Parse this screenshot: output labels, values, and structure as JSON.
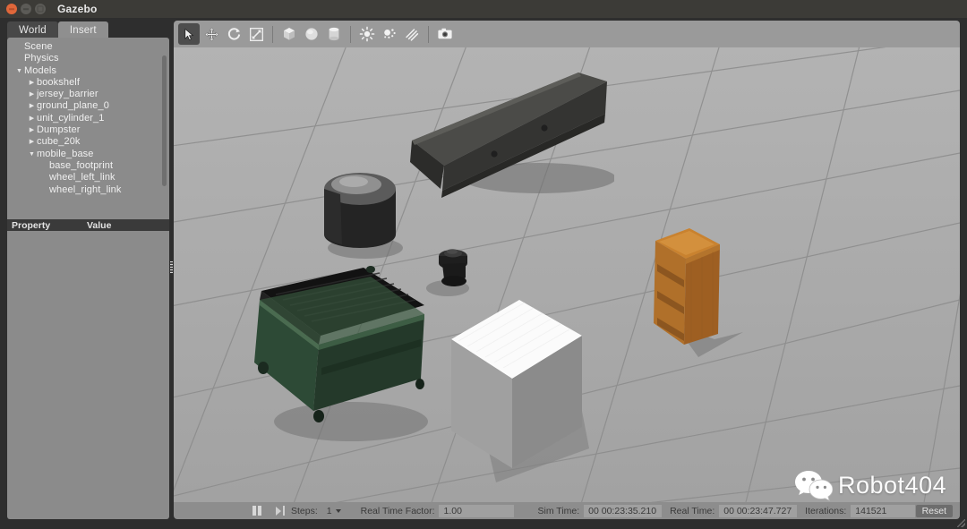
{
  "window": {
    "title": "Gazebo",
    "controls": [
      "close-button",
      "minimize-button",
      "maximize-button"
    ]
  },
  "left_panel": {
    "tabs": [
      {
        "label": "World",
        "active": true
      },
      {
        "label": "Insert",
        "active": false
      }
    ],
    "tree": [
      {
        "label": "Scene",
        "depth": 0,
        "arrow": "none"
      },
      {
        "label": "Physics",
        "depth": 0,
        "arrow": "none"
      },
      {
        "label": "Models",
        "depth": 0,
        "arrow": "expanded"
      },
      {
        "label": "bookshelf",
        "depth": 1,
        "arrow": "collapsed"
      },
      {
        "label": "jersey_barrier",
        "depth": 1,
        "arrow": "collapsed"
      },
      {
        "label": "ground_plane_0",
        "depth": 1,
        "arrow": "collapsed"
      },
      {
        "label": "unit_cylinder_1",
        "depth": 1,
        "arrow": "collapsed"
      },
      {
        "label": "Dumpster",
        "depth": 1,
        "arrow": "collapsed"
      },
      {
        "label": "cube_20k",
        "depth": 1,
        "arrow": "collapsed"
      },
      {
        "label": "mobile_base",
        "depth": 1,
        "arrow": "expanded"
      },
      {
        "label": "base_footprint",
        "depth": 2,
        "arrow": "none"
      },
      {
        "label": "wheel_left_link",
        "depth": 2,
        "arrow": "none"
      },
      {
        "label": "wheel_right_link",
        "depth": 2,
        "arrow": "none"
      }
    ],
    "property_table": {
      "col_property": "Property",
      "col_value": "Value"
    }
  },
  "toolbar": {
    "items": [
      {
        "name": "select-arrow-icon",
        "active": true
      },
      {
        "name": "translate-move-icon",
        "active": false
      },
      {
        "name": "rotate-icon",
        "active": false
      },
      {
        "name": "scale-icon",
        "active": false
      },
      {
        "name": "insert-box-icon",
        "active": false
      },
      {
        "name": "insert-sphere-icon",
        "active": false
      },
      {
        "name": "insert-cylinder-icon",
        "active": false
      },
      {
        "name": "point-light-icon",
        "active": false
      },
      {
        "name": "spot-light-icon",
        "active": false
      },
      {
        "name": "directional-light-icon",
        "active": false
      },
      {
        "name": "screenshot-camera-icon",
        "active": false
      }
    ]
  },
  "scene": {
    "objects": [
      {
        "name": "jersey_barrier",
        "color": "#3a3a38"
      },
      {
        "name": "unit_cylinder_1",
        "color": "#2a2a2a"
      },
      {
        "name": "Dumpster",
        "color": "#2f4434"
      },
      {
        "name": "mobile_base",
        "color": "#1f1f1f"
      },
      {
        "name": "cube_20k",
        "color": "#f4f4f4"
      },
      {
        "name": "bookshelf",
        "color": "#b5712c"
      },
      {
        "name": "ground_plane_0",
        "color": "#a9a9a9"
      }
    ]
  },
  "statusbar": {
    "pause_label": "pause-button",
    "step_label": "step-button",
    "steps_label": "Steps:",
    "steps_value": "1",
    "rtf_label": "Real Time Factor:",
    "rtf_value": "1.00",
    "sim_time_label": "Sim Time:",
    "sim_time_value": "00 00:23:35.210",
    "real_time_label": "Real Time:",
    "real_time_value": "00 00:23:47.727",
    "iterations_label": "Iterations:",
    "iterations_value": "141521",
    "reset_label": "Reset"
  },
  "watermark": {
    "text": "Robot404",
    "icon": "wechat-logo-icon"
  }
}
